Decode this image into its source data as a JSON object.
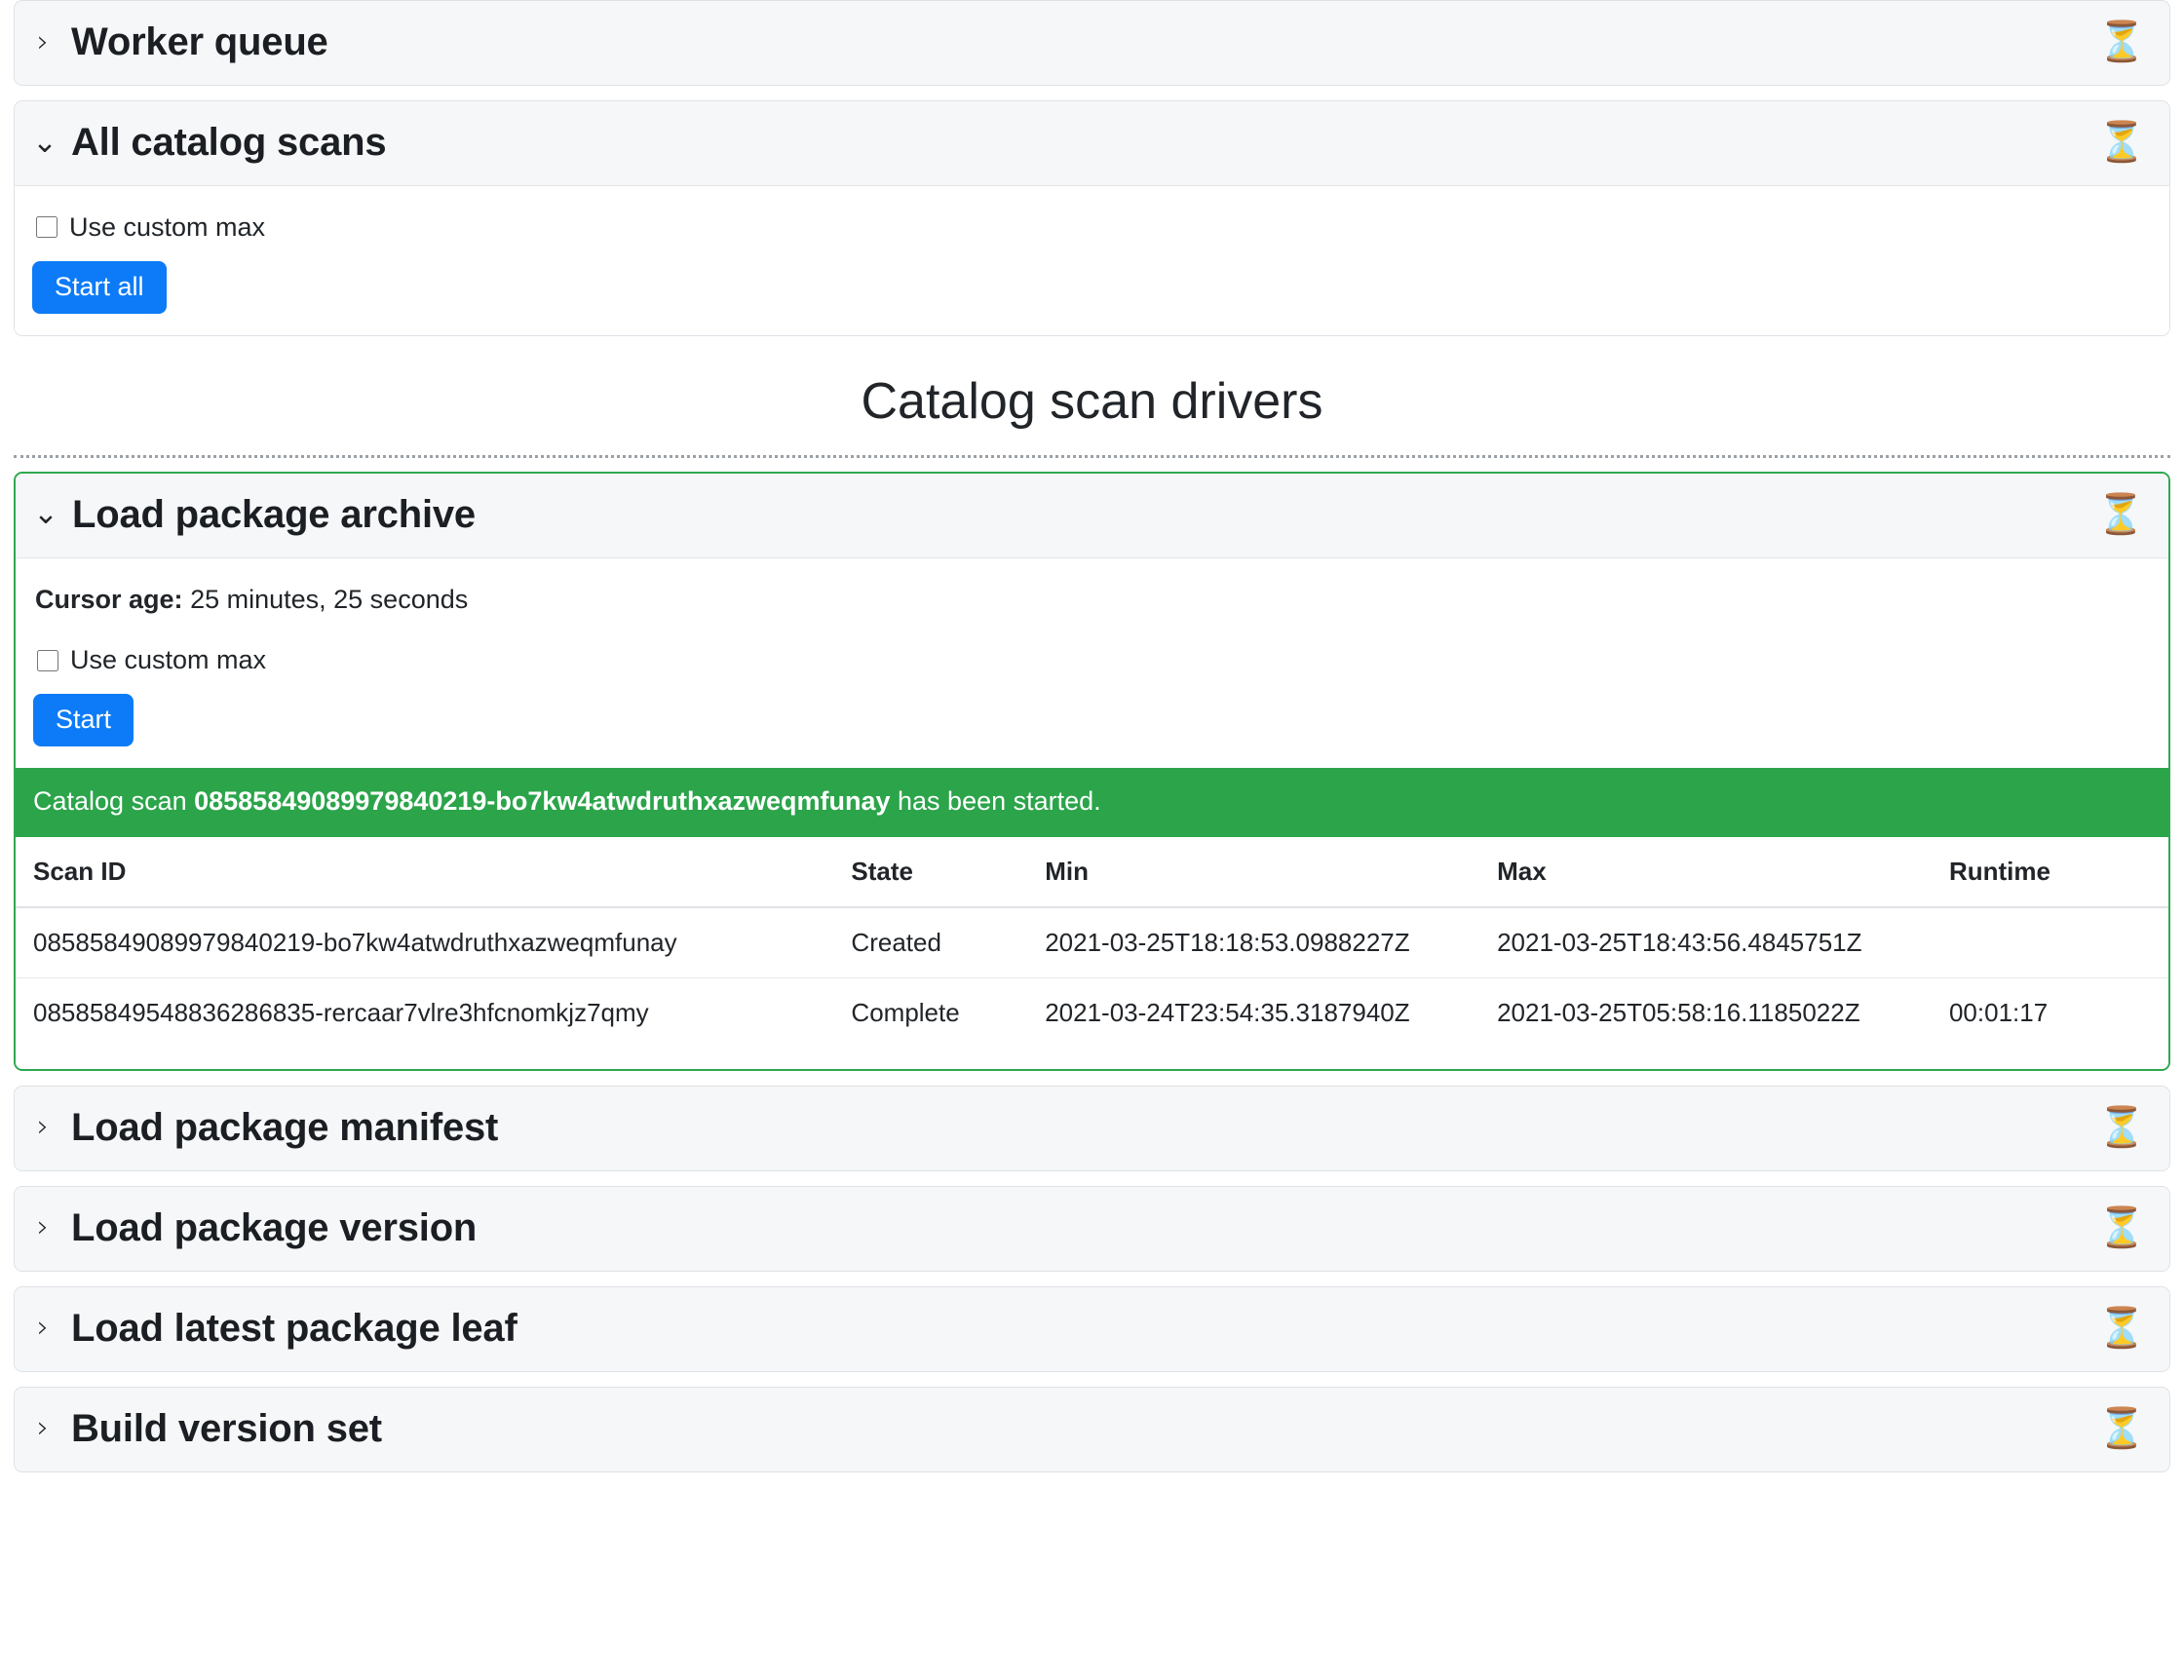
{
  "icons": {
    "hourglass": "⏳",
    "chevron_right": "›",
    "chevron_down": "⌄"
  },
  "worker_queue": {
    "title": "Worker queue",
    "expanded": false
  },
  "all_catalog_scans": {
    "title": "All catalog scans",
    "expanded": true,
    "use_custom_max_label": "Use custom max",
    "start_all_label": "Start all"
  },
  "section": {
    "heading": "Catalog scan drivers"
  },
  "load_package_archive": {
    "title": "Load package archive",
    "expanded": true,
    "cursor_age_label": "Cursor age:",
    "cursor_age_value": "25 minutes, 25 seconds",
    "use_custom_max_label": "Use custom max",
    "start_label": "Start",
    "alert": {
      "prefix": "Catalog scan ",
      "scan_id": "08585849089979840219-bo7kw4atwdruthxazweqmfunay",
      "suffix": " has been started."
    },
    "table": {
      "columns": [
        "Scan ID",
        "State",
        "Min",
        "Max",
        "Runtime"
      ],
      "rows": [
        {
          "scan_id": "08585849089979840219-bo7kw4atwdruthxazweqmfunay",
          "state": "Created",
          "min": "2021-03-25T18:18:53.0988227Z",
          "max": "2021-03-25T18:43:56.4845751Z",
          "runtime": ""
        },
        {
          "scan_id": "08585849548836286835-rercaar7vlre3hfcnomkjz7qmy",
          "state": "Complete",
          "min": "2021-03-24T23:54:35.3187940Z",
          "max": "2021-03-25T05:58:16.1185022Z",
          "runtime": "00:01:17"
        }
      ]
    }
  },
  "collapsed_drivers": [
    {
      "title": "Load package manifest"
    },
    {
      "title": "Load package version"
    },
    {
      "title": "Load latest package leaf"
    },
    {
      "title": "Build version set"
    }
  ],
  "colors": {
    "primary": "#0d7bf7",
    "success": "#2ba44a",
    "success_border": "#2fa84f",
    "card_header_bg": "#f6f7f8",
    "card_border": "#dee2e6"
  }
}
